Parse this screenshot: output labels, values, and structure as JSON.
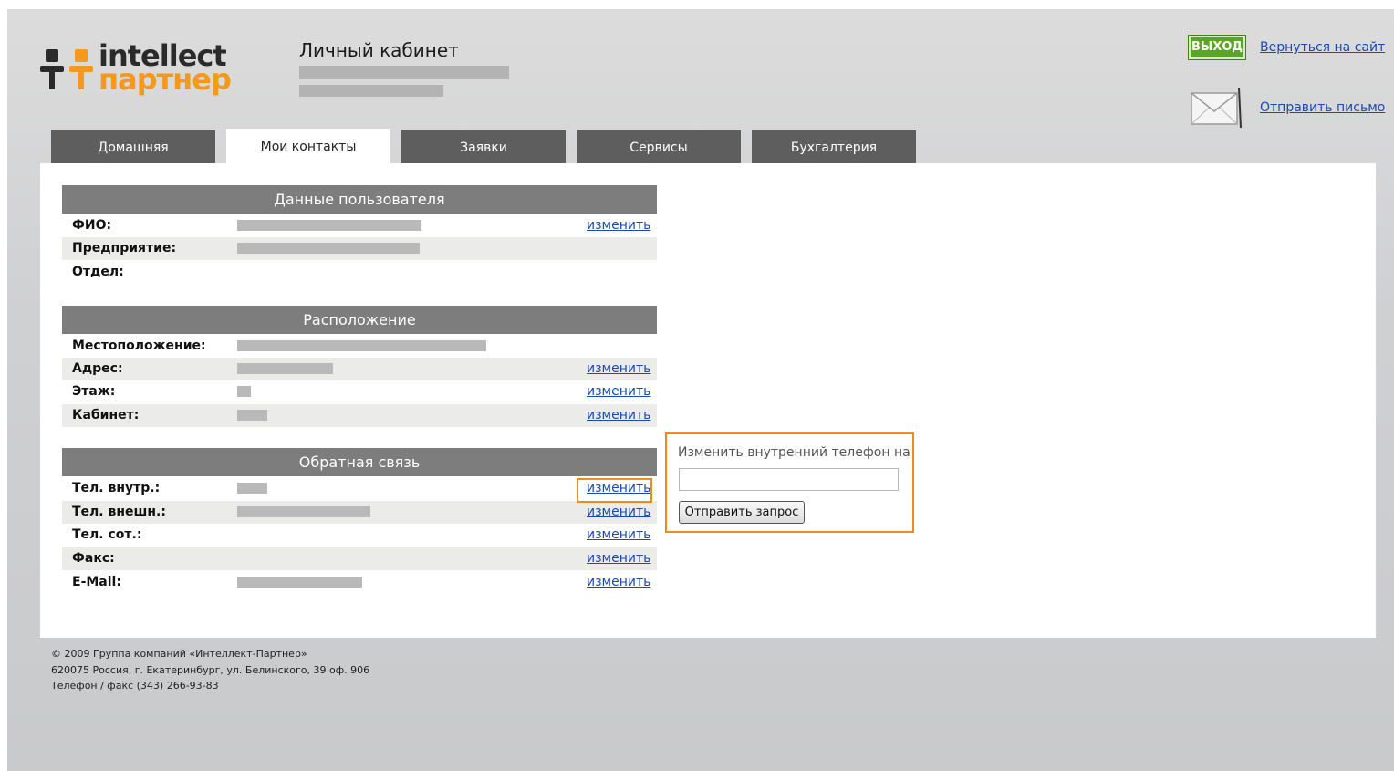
{
  "header": {
    "logo_top": "intellect",
    "logo_bottom": "партнер",
    "title": "Личный кабинет",
    "exit_label": "ВЫХОД",
    "back_link": "Вернуться на сайт",
    "send_letter": "Отправить письмо",
    "mail_icon": "envelope-icon"
  },
  "tabs": [
    {
      "label": "Домашняя",
      "active": false
    },
    {
      "label": "Мои контакты",
      "active": true
    },
    {
      "label": "Заявки",
      "active": false
    },
    {
      "label": "Сервисы",
      "active": false
    },
    {
      "label": "Бухгалтерия",
      "active": false
    }
  ],
  "sections": {
    "user": {
      "title": "Данные пользователя",
      "rows": [
        {
          "label": "ФИО:",
          "edit": "изменить"
        },
        {
          "label": "Предприятие:"
        },
        {
          "label": "Отдел:"
        }
      ]
    },
    "location": {
      "title": "Расположение",
      "rows": [
        {
          "label": "Местоположение:"
        },
        {
          "label": "Адрес:",
          "edit": "изменить"
        },
        {
          "label": "Этаж:",
          "edit": "изменить"
        },
        {
          "label": "Кабинет:",
          "edit": "изменить"
        }
      ]
    },
    "feedback": {
      "title": "Обратная связь",
      "rows": [
        {
          "label": "Тел. внутр.:",
          "edit": "изменить"
        },
        {
          "label": "Тел. внешн.:",
          "edit": "изменить"
        },
        {
          "label": "Тел. сот.:",
          "edit": "изменить"
        },
        {
          "label": "Факс:",
          "edit": "изменить"
        },
        {
          "label": "E-Mail:",
          "edit": "изменить"
        }
      ]
    }
  },
  "popup": {
    "title": "Изменить внутренний телефон на",
    "input_value": "",
    "submit_label": "Отправить запрос"
  },
  "footer": {
    "line1": "© 2009 Группа компаний «Интеллект-Партнер»",
    "line2": "620075 Россия, г. Екатеринбург, ул. Белинского, 39 оф. 906",
    "line3": "Телефон / факс (343) 266-93-83"
  },
  "colors": {
    "accent_orange": "#ef8a1b",
    "tab_dark": "#5e5e5e",
    "section_head": "#7d7d7d",
    "exit_green": "#5aa527",
    "link_blue": "#1a49b8"
  }
}
